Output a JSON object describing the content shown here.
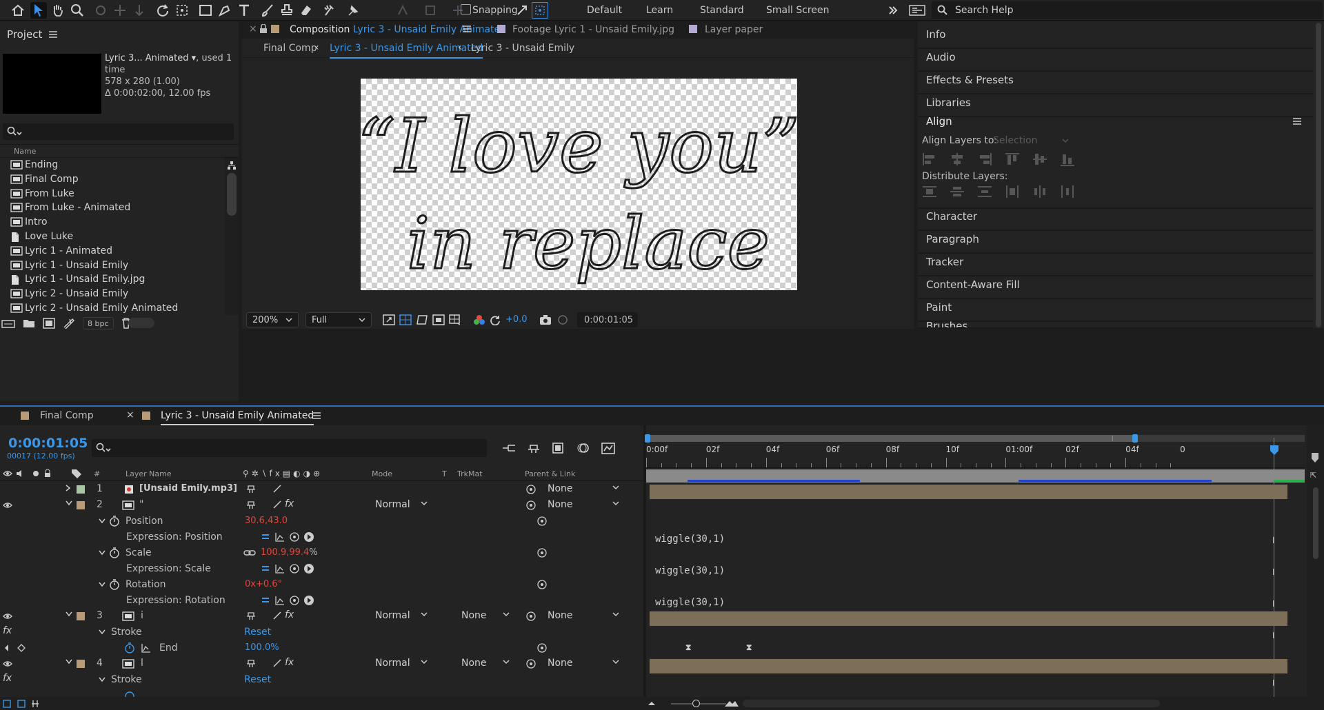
{
  "toolbar": {
    "snapping_label": "Snapping",
    "workspaces": [
      "Default",
      "Learn",
      "Standard",
      "Small Screen"
    ],
    "search_placeholder": "Search Help",
    "icons": [
      "home-icon",
      "selection-tool-icon",
      "hand-tool-icon",
      "zoom-tool-icon",
      "orbit-camera-icon",
      "pan-camera-icon",
      "dolly-camera-icon",
      "rotate-tool-icon",
      "pan-behind-icon",
      "rectangle-tool-icon",
      "pen-tool-icon",
      "type-tool-icon",
      "brush-tool-icon",
      "clone-stamp-icon",
      "eraser-icon",
      "roto-brush-icon",
      "puppet-pin-icon"
    ]
  },
  "project": {
    "title": "Project",
    "preview_name": "Lyric 3... Animated ▾",
    "used": ", used 1 time",
    "dims": "578 x 280 (1.00)",
    "duration": "Δ 0:00:02:00, 12.00 fps",
    "search_placeholder": "",
    "name_header": "Name",
    "bpc": "8 bpc",
    "items": [
      {
        "name": "Ending",
        "type": "comp"
      },
      {
        "name": "Final Comp",
        "type": "comp"
      },
      {
        "name": "From Luke",
        "type": "comp"
      },
      {
        "name": "From Luke - Animated",
        "type": "comp"
      },
      {
        "name": "Intro",
        "type": "comp"
      },
      {
        "name": "Love Luke",
        "type": "file"
      },
      {
        "name": "Lyric 1 - Animated",
        "type": "comp"
      },
      {
        "name": "Lyric 1 - Unsaid Emily",
        "type": "comp"
      },
      {
        "name": "Lyric 1 - Unsaid Emily.jpg",
        "type": "file"
      },
      {
        "name": "Lyric 2 - Unsaid Emily",
        "type": "comp"
      },
      {
        "name": "Lyric 2 - Unsaid Emily Animated",
        "type": "comp"
      }
    ]
  },
  "viewer": {
    "tab_prefix": "Composition",
    "tab_comp": "Lyric 3 - Unsaid Emily Animated",
    "tab_footage": "Footage Lyric 1 - Unsaid Emily.jpg",
    "tab_layer": "Layer paper",
    "breadcrumbs": [
      "Final Comp",
      "Lyric 3 - Unsaid Emily Animated",
      "Lyric 3 - Unsaid Emily"
    ],
    "zoom": "200%",
    "resolution": "Full",
    "exposure": "+0.0",
    "timecode": "0:00:01:05"
  },
  "right": {
    "items": [
      "Info",
      "Audio",
      "Effects & Presets",
      "Libraries"
    ],
    "align_title": "Align",
    "align_layers_to": "Align Layers to:",
    "align_target": "Selection",
    "distribute": "Distribute Layers:",
    "items2": [
      "Character",
      "Paragraph",
      "Tracker",
      "Content-Aware Fill",
      "Paint",
      "Brushes"
    ]
  },
  "timeline": {
    "tabs": [
      "Final Comp",
      "Lyric 3 - Unsaid Emily Animated"
    ],
    "timecode": "0:00:01:05",
    "frames": "00017 (12.00 fps)",
    "headers": {
      "num": "#",
      "layer_name": "Layer Name",
      "mode": "Mode",
      "t": "T",
      "trkmat": "TrkMat",
      "parent": "Parent & Link"
    },
    "ruler": [
      "0:00f",
      "02f",
      "04f",
      "06f",
      "08f",
      "10f",
      "01:00f",
      "02f",
      "04f",
      "0"
    ],
    "layers": [
      {
        "num": "1",
        "name": "[Unsaid Emily.mp3]",
        "parent": "None"
      },
      {
        "num": "2",
        "name": "\"",
        "mode": "Normal",
        "parent": "None"
      },
      {
        "num": "3",
        "name": "i",
        "mode": "Normal",
        "trkmat": "None",
        "parent": "None"
      },
      {
        "num": "4",
        "name": "l",
        "mode": "Normal",
        "trkmat": "None",
        "parent": "None"
      }
    ],
    "props": {
      "position": "Position",
      "position_val": "30.6,43.0",
      "expr_position": "Expression: Position",
      "scale": "Scale",
      "scale_val": "100.9,99.4",
      "scale_unit": "%",
      "expr_scale": "Expression: Scale",
      "rotation": "Rotation",
      "rotation_val": "0x+0.6°",
      "expr_rotation": "Expression: Rotation",
      "stroke": "Stroke",
      "reset": "Reset",
      "end": "End",
      "end_val": "100.0%",
      "stroke2": "Stroke",
      "reset2": "Reset"
    },
    "expression": "wiggle(30,1)"
  },
  "canvas_text": {
    "line1": "“I love you”",
    "line2": "in replace"
  }
}
